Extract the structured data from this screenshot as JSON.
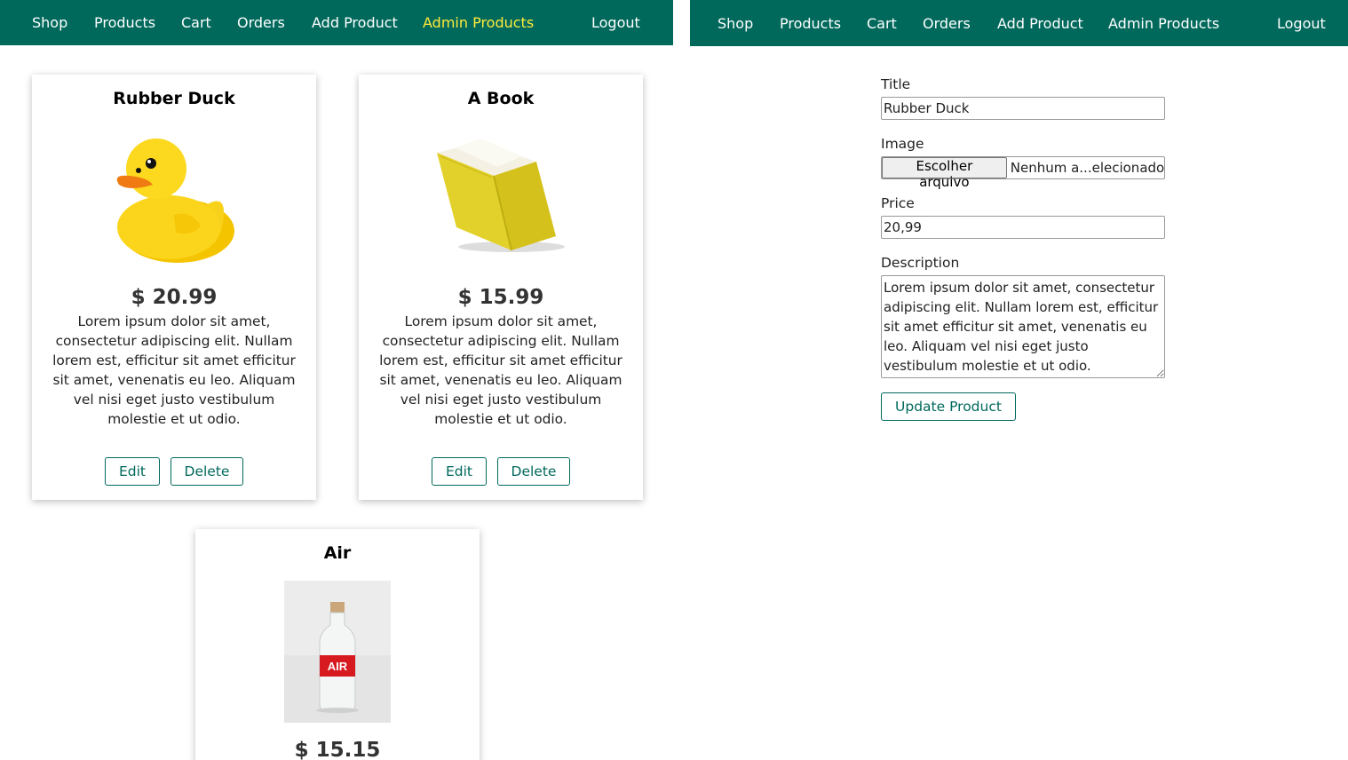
{
  "left_panel": {
    "nav": {
      "shop": "Shop",
      "products": "Products",
      "cart": "Cart",
      "orders": "Orders",
      "add_product": "Add Product",
      "admin_products": "Admin Products",
      "logout": "Logout"
    },
    "products": [
      {
        "title": "Rubber Duck",
        "price": "$ 20.99",
        "description": "Lorem ipsum dolor sit amet, consectetur adipiscing elit. Nullam lorem est, efficitur sit amet efficitur sit amet, venenatis eu leo. Aliquam vel nisi eget justo vestibulum molestie et ut odio.",
        "edit_label": "Edit",
        "delete_label": "Delete"
      },
      {
        "title": "A Book",
        "price": "$ 15.99",
        "description": "Lorem ipsum dolor sit amet, consectetur adipiscing elit. Nullam lorem est, efficitur sit amet efficitur sit amet, venenatis eu leo. Aliquam vel nisi eget justo vestibulum molestie et ut odio.",
        "edit_label": "Edit",
        "delete_label": "Delete"
      },
      {
        "title": "Air",
        "price": "$ 15.15",
        "image_label": "AIR"
      }
    ]
  },
  "right_panel": {
    "nav": {
      "shop": "Shop",
      "products": "Products",
      "cart": "Cart",
      "orders": "Orders",
      "add_product": "Add Product",
      "admin_products": "Admin Products",
      "logout": "Logout"
    },
    "form": {
      "title_label": "Title",
      "title_value": "Rubber Duck",
      "image_label": "Image",
      "file_button": "Escolher arquivo",
      "file_status": "Nenhum a...elecionado",
      "price_label": "Price",
      "price_value": "20,99",
      "description_label": "Description",
      "description_value": "Lorem ipsum dolor sit amet, consectetur adipiscing elit. Nullam lorem est, efficitur sit amet efficitur sit amet, venenatis eu leo. Aliquam vel nisi eget justo vestibulum molestie et ut odio.",
      "submit_label": "Update Product"
    }
  },
  "colors": {
    "navbar": "#00695c",
    "active_nav": "#ffeb3b",
    "button_border": "#00695c"
  }
}
